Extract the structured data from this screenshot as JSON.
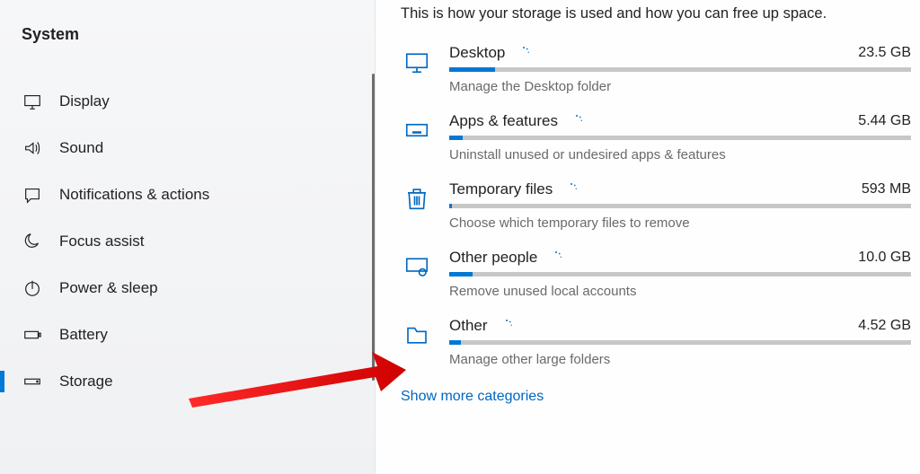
{
  "sidebar": {
    "title": "System",
    "items": [
      {
        "label": "Display",
        "icon": "monitor-icon"
      },
      {
        "label": "Sound",
        "icon": "speaker-icon"
      },
      {
        "label": "Notifications & actions",
        "icon": "chat-icon"
      },
      {
        "label": "Focus assist",
        "icon": "moon-icon"
      },
      {
        "label": "Power & sleep",
        "icon": "power-icon"
      },
      {
        "label": "Battery",
        "icon": "battery-icon"
      },
      {
        "label": "Storage",
        "icon": "drive-icon"
      }
    ]
  },
  "intro": "This is how your storage is used and how you can free up space.",
  "categories": [
    {
      "name": "Desktop",
      "size": "23.5 GB",
      "sub": "Manage the Desktop folder",
      "icon": "monitor-icon",
      "fill": 10
    },
    {
      "name": "Apps & features",
      "size": "5.44 GB",
      "sub": "Uninstall unused or undesired apps & features",
      "icon": "keyboard-icon",
      "fill": 3
    },
    {
      "name": "Temporary files",
      "size": "593 MB",
      "sub": "Choose which temporary files to remove",
      "icon": "trash-icon",
      "fill": 0.5
    },
    {
      "name": "Other people",
      "size": "10.0 GB",
      "sub": "Remove unused local accounts",
      "icon": "people-icon",
      "fill": 5
    },
    {
      "name": "Other",
      "size": "4.52 GB",
      "sub": "Manage other large folders",
      "icon": "folder-icon",
      "fill": 2.5
    }
  ],
  "more": "Show more categories"
}
